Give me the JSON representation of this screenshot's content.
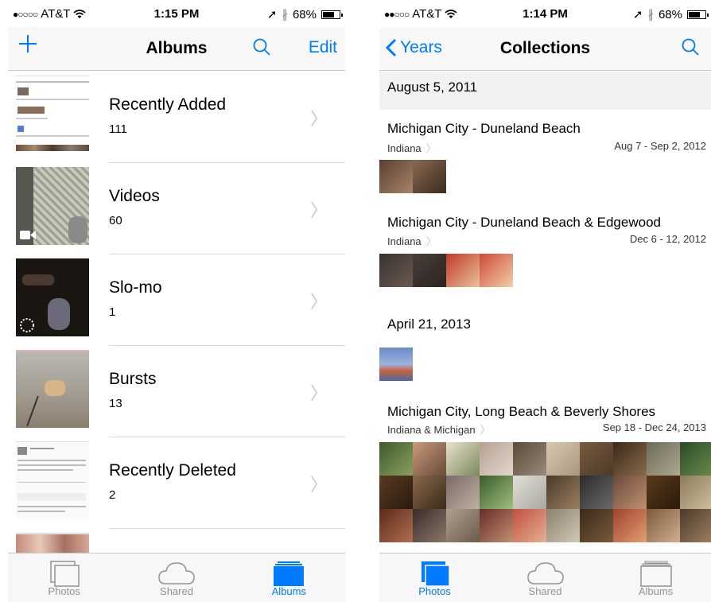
{
  "left": {
    "status": {
      "carrier": "AT&T",
      "time": "1:15 PM",
      "battery": "68%"
    },
    "nav": {
      "title": "Albums",
      "edit_label": "Edit"
    },
    "albums": [
      {
        "name": "Recently Added",
        "count": "111"
      },
      {
        "name": "Videos",
        "count": "60"
      },
      {
        "name": "Slo-mo",
        "count": "1"
      },
      {
        "name": "Bursts",
        "count": "13"
      },
      {
        "name": "Recently Deleted",
        "count": "2"
      }
    ],
    "tabs": [
      {
        "label": "Photos",
        "icon": "photos-icon"
      },
      {
        "label": "Shared",
        "icon": "cloud-icon"
      },
      {
        "label": "Albums",
        "icon": "albums-icon"
      }
    ],
    "active_tab": "Albums"
  },
  "right": {
    "status": {
      "carrier": "AT&T",
      "time": "1:14 PM",
      "battery": "68%"
    },
    "nav": {
      "back_label": "Years",
      "title": "Collections"
    },
    "sections": [
      {
        "date": "August 5, 2011"
      },
      {
        "title": "Michigan City - Duneland Beach",
        "location": "Indiana",
        "range": "Aug 7 - Sep 2, 2012"
      },
      {
        "title": "Michigan City - Duneland Beach & Edgewood",
        "location": "Indiana",
        "range": "Dec 6 - 12, 2012"
      },
      {
        "date": "April 21, 2013"
      },
      {
        "title": "Michigan City, Long Beach & Beverly Shores",
        "location": "Indiana & Michigan",
        "range": "Sep 18 - Dec 24, 2013"
      }
    ],
    "tabs": [
      {
        "label": "Photos",
        "icon": "photos-icon"
      },
      {
        "label": "Shared",
        "icon": "cloud-icon"
      },
      {
        "label": "Albums",
        "icon": "albums-icon"
      }
    ],
    "active_tab": "Photos"
  },
  "colors": {
    "accent": "#007aff",
    "separator": "#c8c8cc",
    "tab_inactive": "#929292"
  }
}
